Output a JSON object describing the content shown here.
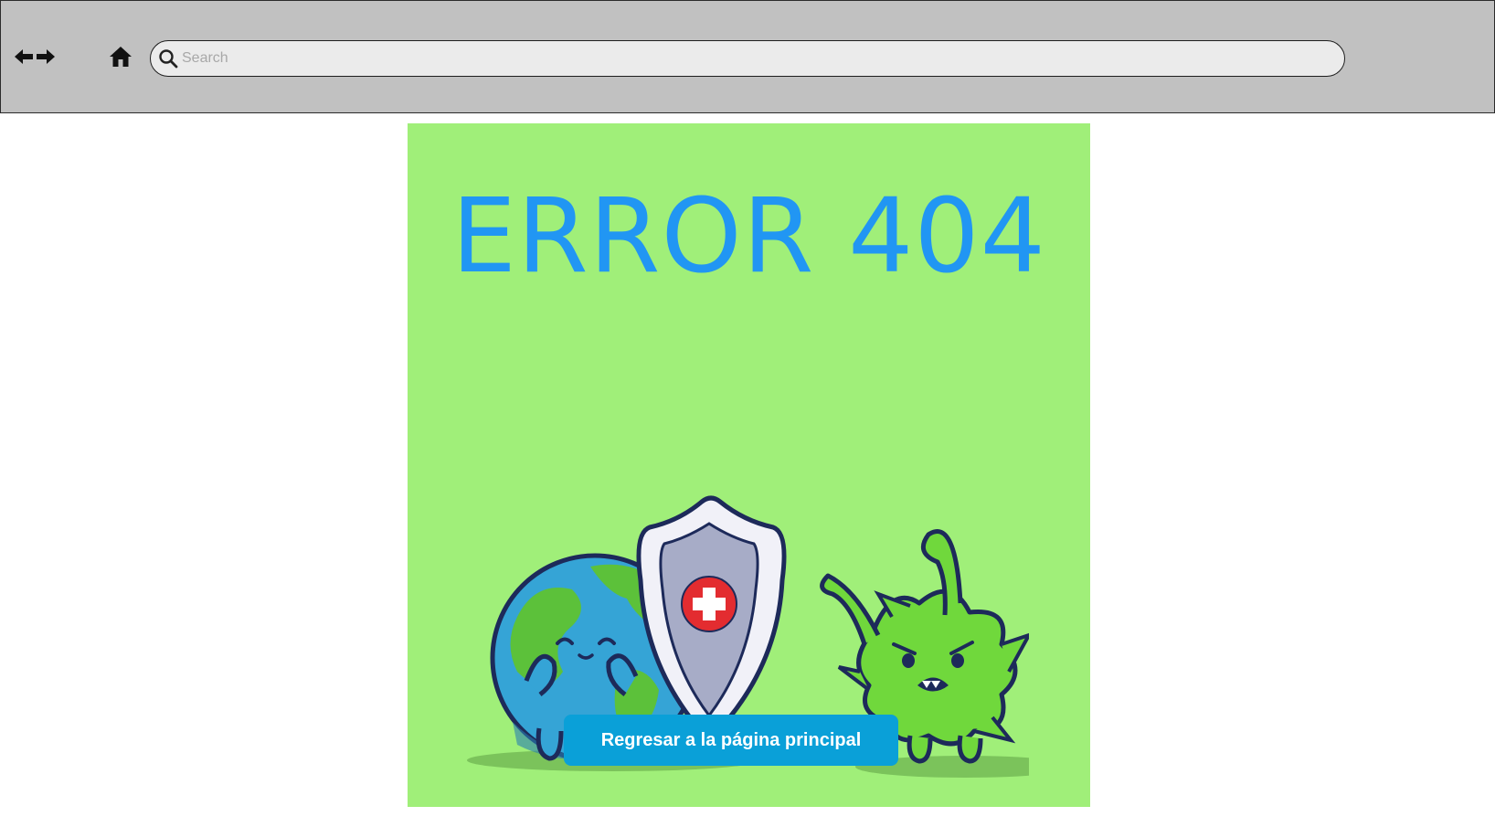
{
  "browser": {
    "search": {
      "placeholder": "Search",
      "value": ""
    }
  },
  "icons": {
    "back": "left-arrow-icon",
    "forward": "right-arrow-icon",
    "home": "home-icon",
    "search": "search-icon"
  },
  "page": {
    "title": "ERROR 404",
    "button_label": "Regresar a la página principal"
  },
  "colors": {
    "toolbar": "#c1c1c1",
    "card": "#a0ef79",
    "title": "#2196f3",
    "button": "#0aa0d8"
  }
}
